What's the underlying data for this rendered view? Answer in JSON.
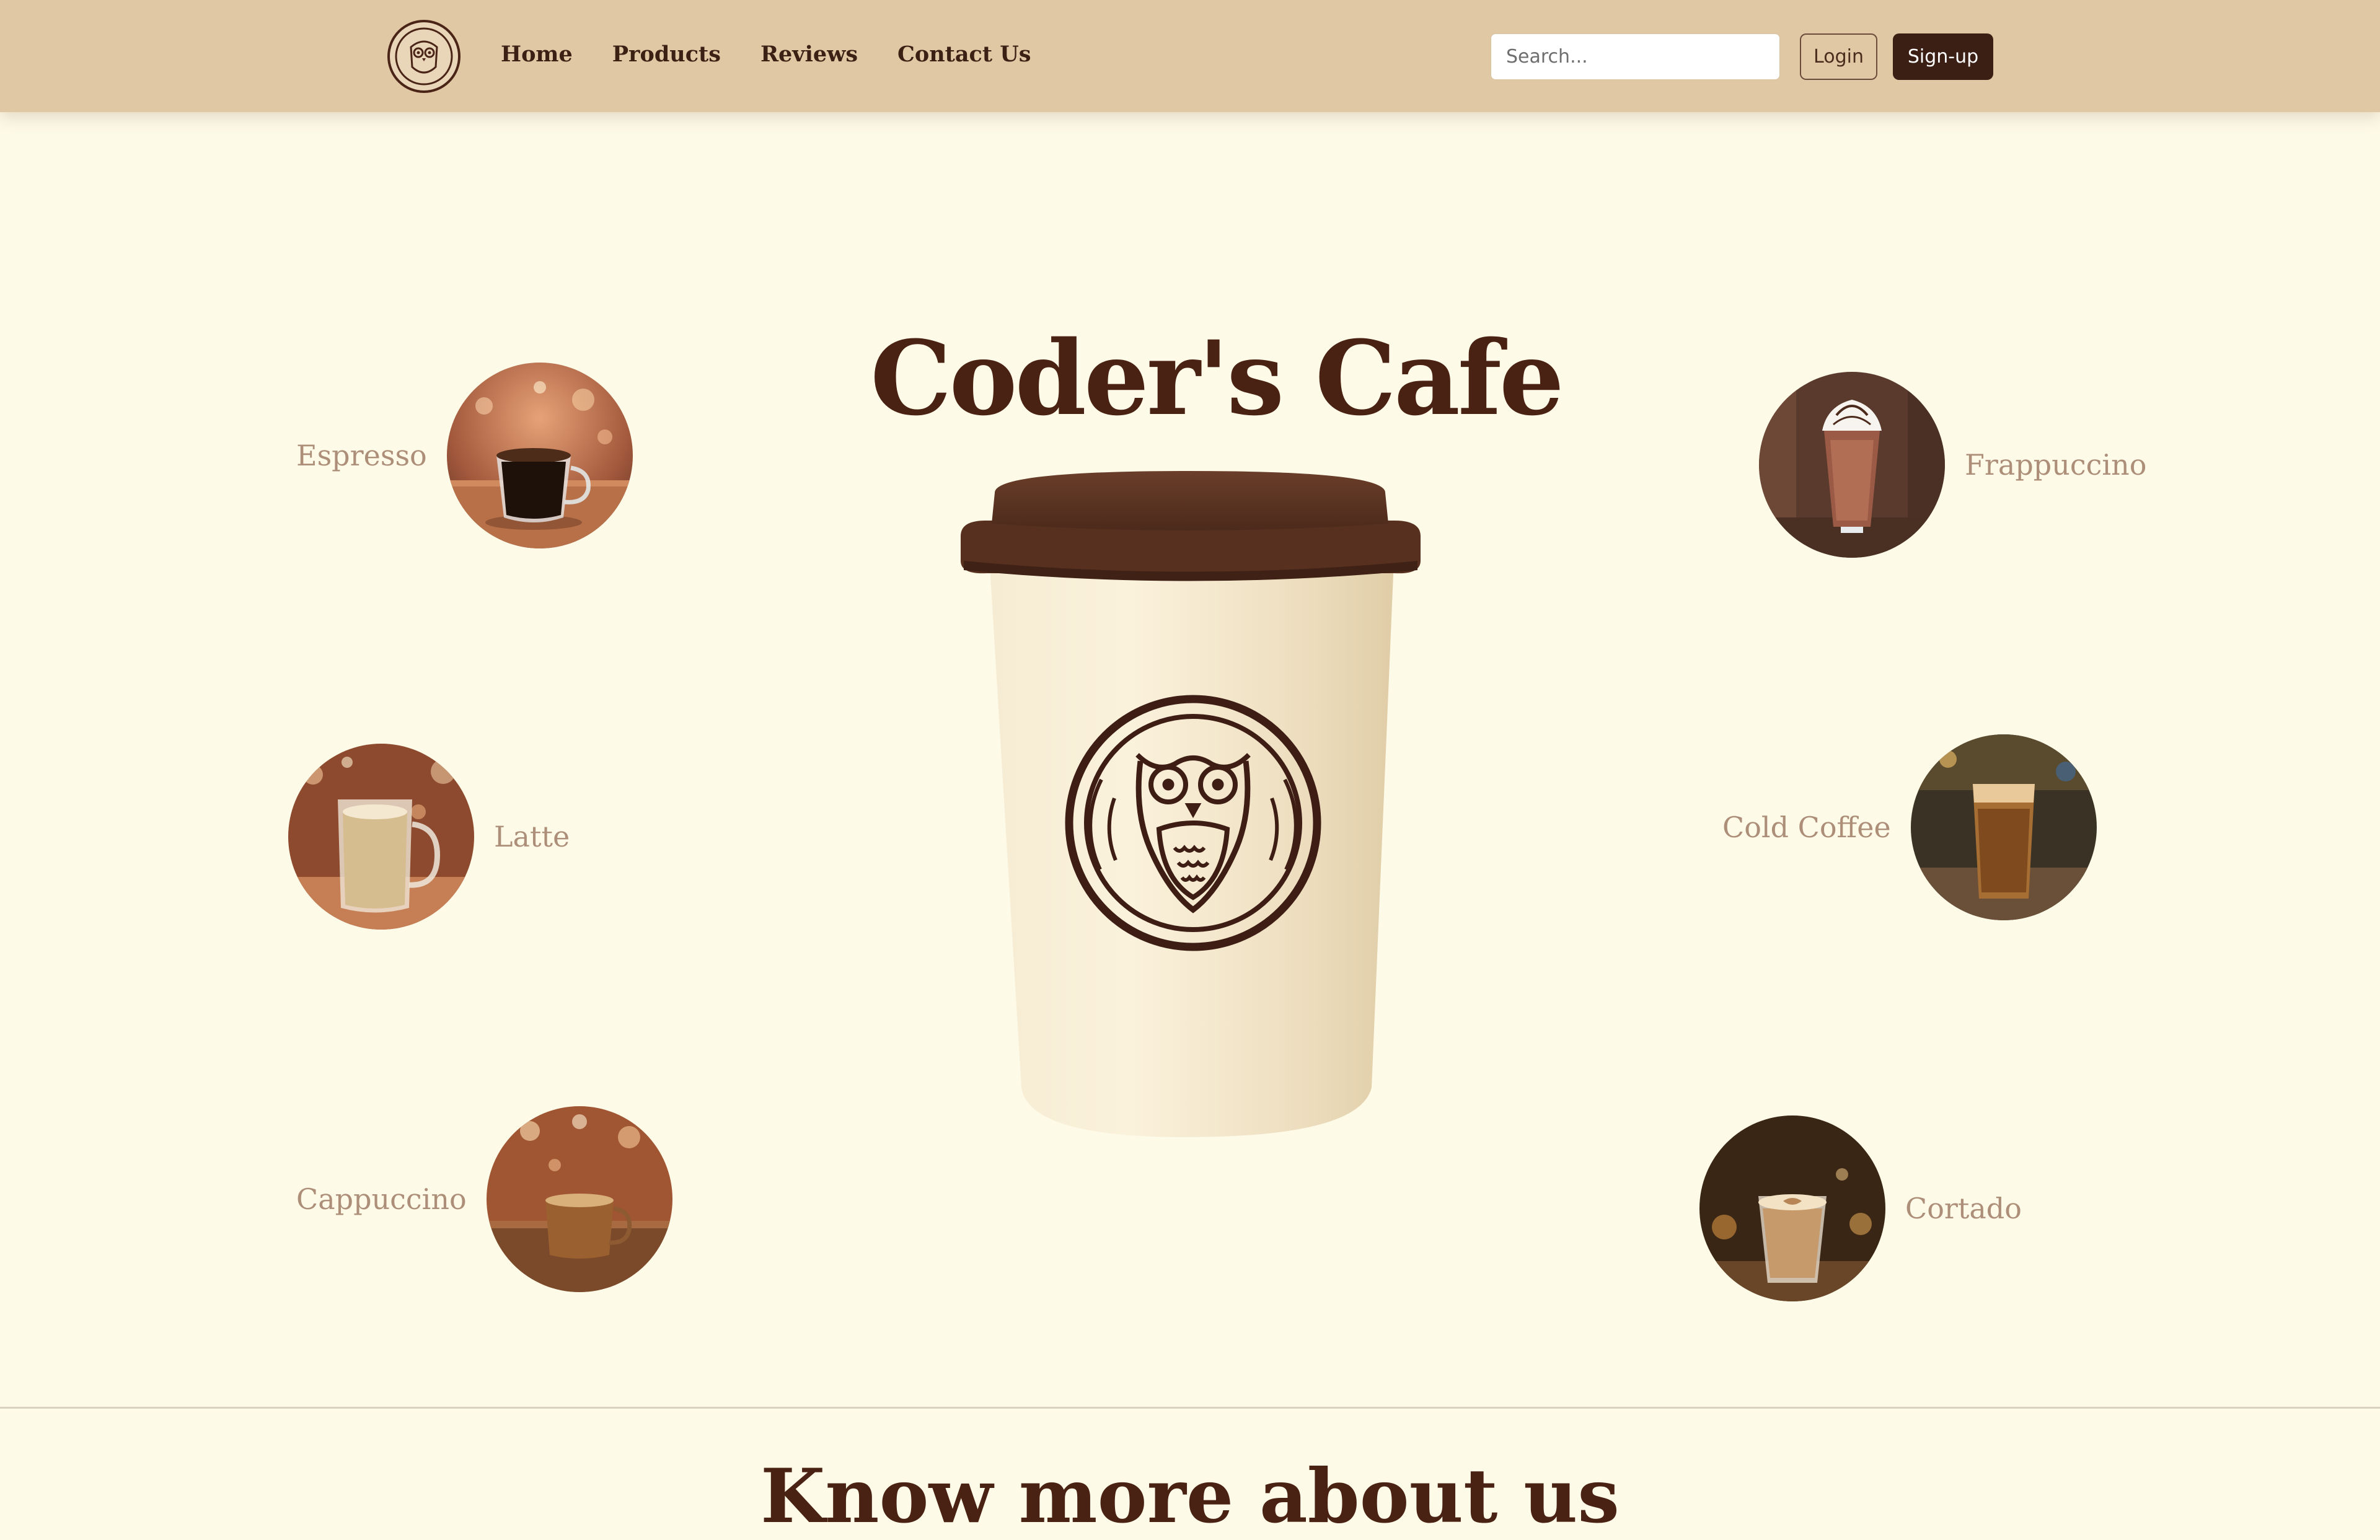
{
  "nav": {
    "logo_icon": "owl-logo-icon",
    "links": [
      "Home",
      "Products",
      "Reviews",
      "Contact Us"
    ],
    "search_placeholder": "Search...",
    "login_label": "Login",
    "signup_label": "Sign-up"
  },
  "hero": {
    "title": "Coder's Cafe",
    "cup_icon": "coffee-cup-owl-icon"
  },
  "products": [
    {
      "name": "Espresso"
    },
    {
      "name": "Latte"
    },
    {
      "name": "Cappuccino"
    },
    {
      "name": "Frappuccino"
    },
    {
      "name": "Cold Coffee"
    },
    {
      "name": "Cortado"
    }
  ],
  "section2": {
    "heading": "Know more about us"
  },
  "colors": {
    "background": "#fefae8",
    "navbar": "#e1c8a4",
    "brand_dark": "#3b1e14",
    "title": "#4a2213",
    "product_label": "#ad8f79"
  }
}
